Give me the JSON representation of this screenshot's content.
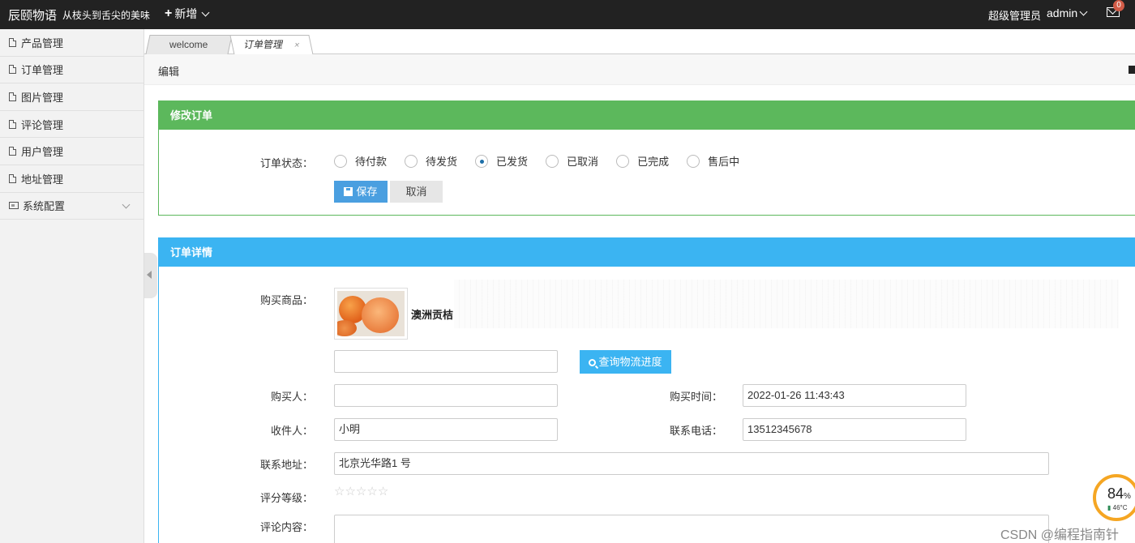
{
  "header": {
    "brand": "辰颐物语",
    "tagline": "从枝头到舌尖的美味",
    "add_label": "新增",
    "role": "超级管理员",
    "user": "admin",
    "mail_count": "0"
  },
  "sidebar": {
    "items": [
      {
        "label": "产品管理"
      },
      {
        "label": "订单管理"
      },
      {
        "label": "图片管理"
      },
      {
        "label": "评论管理"
      },
      {
        "label": "用户管理"
      },
      {
        "label": "地址管理"
      },
      {
        "label": "系统配置"
      }
    ]
  },
  "tabs": {
    "welcome": "welcome",
    "order": "订单管理",
    "close_glyph": "×"
  },
  "breadcrumb": "编辑",
  "edit_panel": {
    "title": "修改订单",
    "status_label": "订单状态：",
    "statuses": [
      "待付款",
      "待发货",
      "已发货",
      "已取消",
      "已完成",
      "售后中"
    ],
    "selected_status": "已发货",
    "save_label": "保存",
    "cancel_label": "取消"
  },
  "detail_panel": {
    "title": "订单详情",
    "product_label": "购买商品：",
    "product_name": "澳洲贡桔",
    "tracking_value": "",
    "track_button": "查询物流进度",
    "buyer_label": "购买人：",
    "buyer_value": "",
    "time_label": "购买时间：",
    "time_value": "2022-01-26 11:43:43",
    "receiver_label": "收件人：",
    "receiver_value": "小明",
    "phone_label": "联系电话：",
    "phone_value": "13512345678",
    "address_label": "联系地址：",
    "address_value": "北京光华路1 号",
    "rating_label": "评分等级：",
    "rating_value": 0,
    "rating_max": 5,
    "comment_label": "评论内容："
  },
  "overlay": {
    "gauge_value": "84",
    "gauge_unit": "%",
    "gauge_temp": "46°C",
    "watermark": "CSDN @编程指南针"
  },
  "colors": {
    "edit_header": "#5cb85c",
    "detail_header": "#3bb4f2",
    "save_button": "#4a9fe0"
  }
}
